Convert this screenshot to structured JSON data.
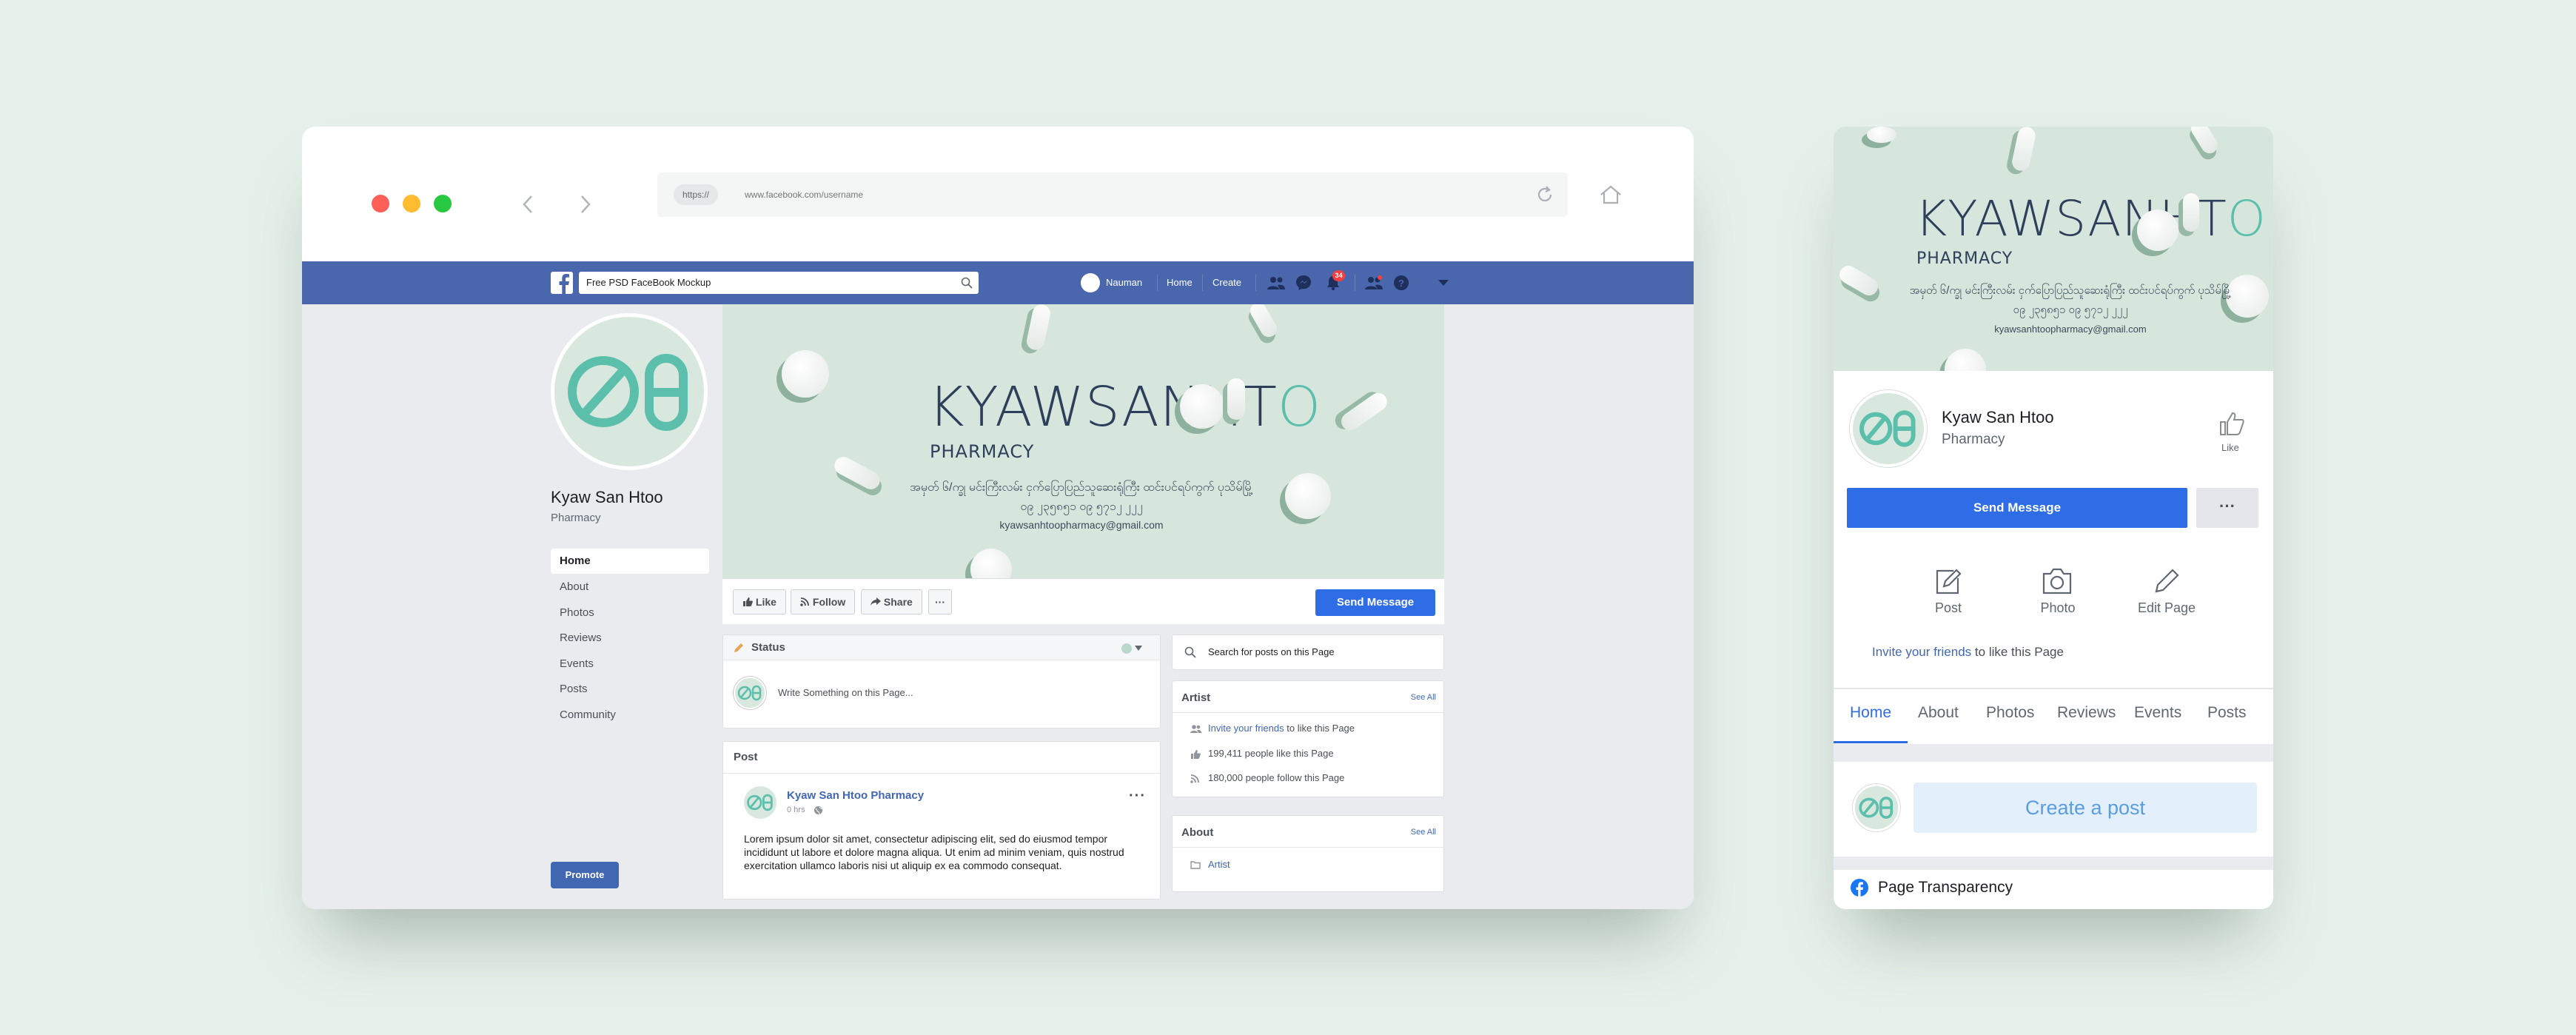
{
  "browser": {
    "url_protocol": "https://",
    "url": "www.facebook.com/username"
  },
  "fb_header": {
    "search_value": "Free PSD FaceBook Mockup",
    "user_name": "Nauman",
    "home": "Home",
    "create": "Create",
    "notification_count": "34"
  },
  "page": {
    "name": "Kyaw San Htoo",
    "category": "Pharmacy",
    "nav": [
      "Home",
      "About",
      "Photos",
      "Reviews",
      "Events",
      "Posts",
      "Community"
    ],
    "promote": "Promote"
  },
  "cover": {
    "brand": "KYAWSANHT",
    "brand_suffix": "O",
    "subtitle": "PHARMACY",
    "burmese_line1": "အမှတ် ၆/က္ခု မင်းကြီးလမ်း ငှက်ပြောပြည်သူဆေးရုံကြီး ထင်းပင်ရပ်ကွက် ပုသိမ်မြို့",
    "burmese_line2": "၀၉ ၂၃၅၈၅၁ ၀၉ ၅၇၁၂ ၂၂၂",
    "email": "kyawsanhtoopharmacy@gmail.com"
  },
  "actions": {
    "like": "Like",
    "follow": "Follow",
    "share": "Share",
    "more": "···",
    "send_message": "Send Message"
  },
  "status": {
    "title": "Status",
    "placeholder": "Write Something on this Page..."
  },
  "post": {
    "section": "Post",
    "author": "Kyaw San Htoo Pharmacy",
    "time": "0 hrs",
    "text": "Lorem ipsum dolor sit amet, consectetur adipiscing elit, sed do eiusmod tempor incididunt ut labore et dolore magna aliqua. Ut enim ad minim veniam, quis nostrud exercitation ullamco laboris nisi ut aliquip ex ea commodo consequat."
  },
  "sidebar": {
    "search_placeholder": "Search for posts on this Page",
    "artist_title": "Artist",
    "see_all": "See All",
    "invite_link": "Invite your friends",
    "invite_rest": "to like this Page",
    "likes": "199,411 people like this Page",
    "follows": "180,000 people follow this Page",
    "about_title": "About",
    "about_item": "Artist"
  },
  "mobile": {
    "name": "Kyaw San Htoo",
    "category": "Pharmacy",
    "like": "Like",
    "send_message": "Send Message",
    "more": "···",
    "post": "Post",
    "photo": "Photo",
    "edit_page": "Edit Page",
    "invite_link": "Invite your friends",
    "invite_rest": "to like this Page",
    "tabs": [
      "Home",
      "About",
      "Photos",
      "Reviews",
      "Events",
      "Posts"
    ],
    "create_post": "Create a post",
    "transparency": "Page Transparency"
  },
  "colors": {
    "background": "#e7f1eb",
    "fb_blue": "#4a67ad",
    "button_blue": "#2f6de6",
    "brand_navy": "#2e3f5b",
    "brand_teal": "#5bbfab",
    "cover_bg": "#d6e6dc"
  }
}
